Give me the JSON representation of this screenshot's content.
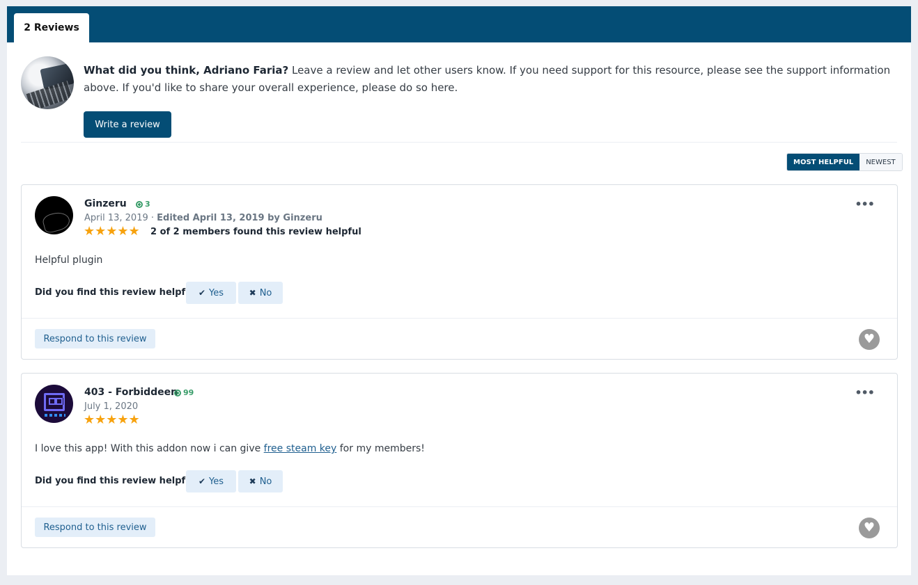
{
  "tabs": {
    "active_label": "2 Reviews"
  },
  "prompt": {
    "bold_text": "What did you think, Adriano Faria?",
    "text": " Leave a review and let other users know. If you need support for this resource, please see the support information above. If you'd like to share your overall experience, please do so here.",
    "write_button": "Write a review"
  },
  "sort": {
    "most_helpful": "MOST HELPFUL",
    "newest": "NEWEST"
  },
  "reviews": [
    {
      "author": "Ginzeru",
      "reputation": "3",
      "date": "April 13, 2019 · ",
      "edited": "Edited April 13, 2019 by Ginzeru",
      "rating": 5,
      "stars": "★★★★★",
      "helpful_count": "2 of 2 members found this review helpful",
      "body_before": "Helpful plugin",
      "body_link": "",
      "body_after": "",
      "question": "Did you find this review helpful?",
      "yes_label": "Yes",
      "no_label": "No",
      "respond_label": "Respond to this review"
    },
    {
      "author": "403 - Forbiddeen",
      "reputation": "99",
      "date": "July 1, 2020",
      "edited": "",
      "rating": 5,
      "stars": "★★★★★",
      "helpful_count": "",
      "body_before": "I love this app! With this addon now i can give ",
      "body_link": "free steam key",
      "body_after": " for my members!",
      "question": "Did you find this review helpful?",
      "yes_label": "Yes",
      "no_label": "No",
      "respond_label": "Respond to this review"
    }
  ],
  "icons": {
    "menu": "•••",
    "check": "✔",
    "cross": "✖",
    "heart": "♥"
  },
  "colors": {
    "brand": "#044d75",
    "star": "#f7a20e",
    "reputation": "#3a9d6a"
  }
}
